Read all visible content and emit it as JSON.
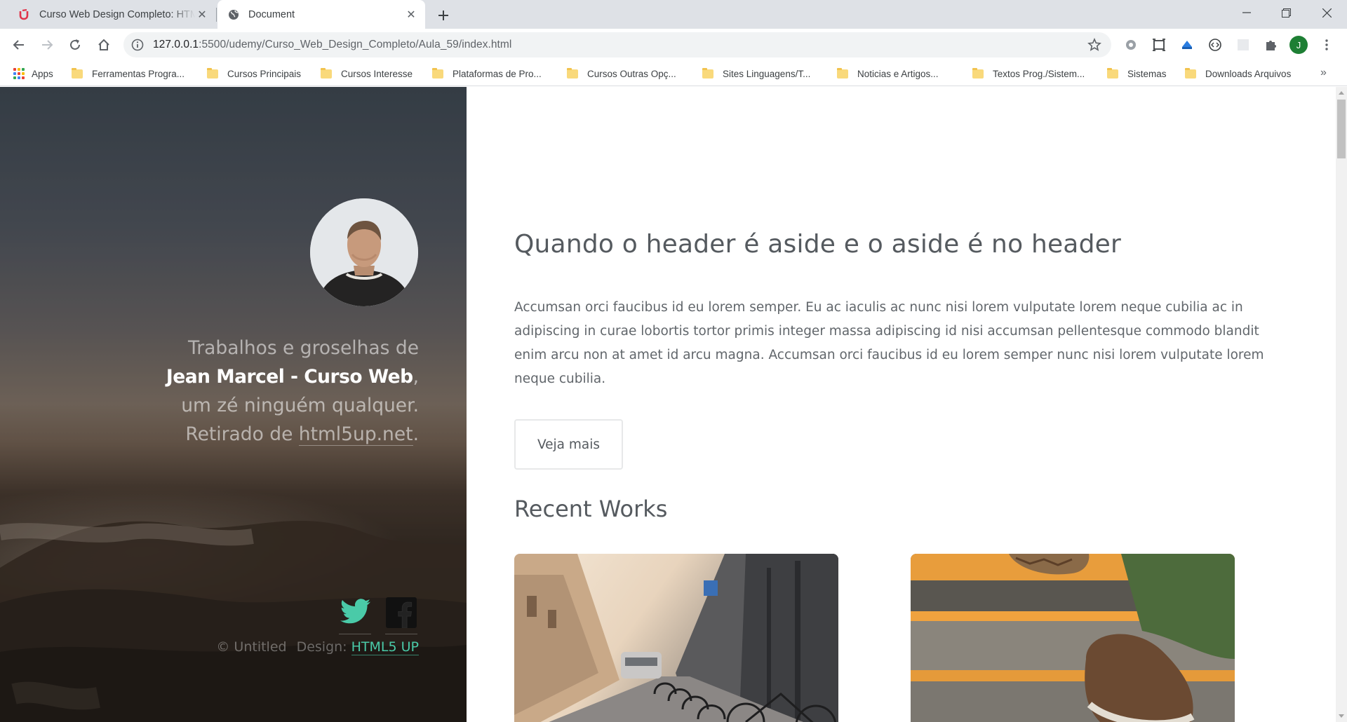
{
  "browser": {
    "tabs": [
      {
        "title": "Curso Web Design Completo: HTML",
        "favicon": "udemy-logo-icon",
        "active": false
      },
      {
        "title": "Document",
        "favicon": "globe-icon",
        "active": true
      }
    ],
    "address": {
      "host": "127.0.0.1",
      "path": ":5500/udemy/Curso_Web_Design_Completo/Aula_59/index.html"
    },
    "profile_initial": "J",
    "colors": {
      "tabstrip": "#dee1e6",
      "profile": "#1e7f34"
    }
  },
  "bookmarks": {
    "apps_label": "Apps",
    "items": [
      "Ferramentas Progra...",
      "Cursos Principais",
      "Cursos Interesse",
      "Plataformas de Pro...",
      "Cursos Outras Opç...",
      "Sites Linguagens/T...",
      "Noticias e Artigos...",
      "Textos Prog./Sistem...",
      "Sistemas",
      "Downloads Arquivos"
    ],
    "more": "»"
  },
  "aside": {
    "intro_line1": "Trabalhos e groselhas de",
    "intro_name": "Jean Marcel - Curso Web",
    "intro_comma": ",",
    "intro_line3": "um zé ninguém qualquer.",
    "intro_line4_prefix": "Retirado de ",
    "intro_link": "html5up.net",
    "intro_period": ".",
    "copyright_text": "© Untitled",
    "design_label": "Design: ",
    "design_link": "HTML5 UP",
    "accent_color": "#4acaa8"
  },
  "main": {
    "heading": "Quando o header é aside e o aside é no header",
    "paragraph": "Accumsan orci faucibus id eu lorem semper. Eu ac iaculis ac nunc nisi lorem vulputate lorem neque cubilia ac in adipiscing in curae lobortis tortor primis integer massa adipiscing id nisi accumsan pellentesque commodo blandit enim arcu non at amet id arcu magna. Accumsan orci faucibus id eu lorem semper nunc nisi lorem vulputate lorem neque cubilia.",
    "button_label": "Veja mais",
    "recent_heading": "Recent Works"
  }
}
